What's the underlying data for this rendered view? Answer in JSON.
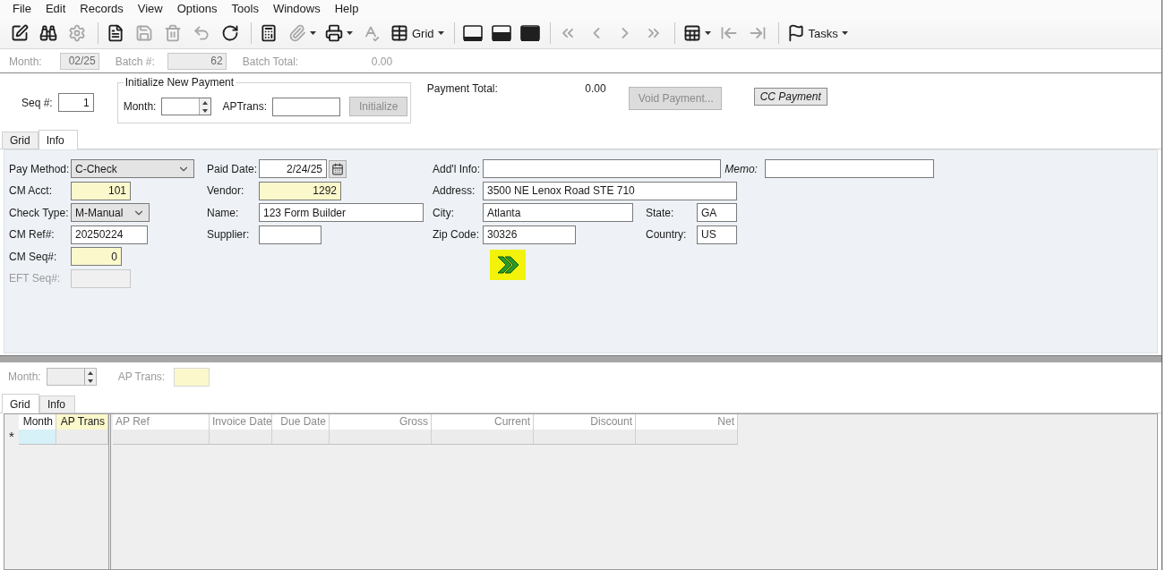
{
  "menu": [
    {
      "label": "File"
    },
    {
      "label": "Edit"
    },
    {
      "label": "Records"
    },
    {
      "label": "View"
    },
    {
      "label": "Options"
    },
    {
      "label": "Tools"
    },
    {
      "label": "Windows"
    },
    {
      "label": "Help"
    }
  ],
  "toolbar": [
    {
      "kind": "button",
      "disabled": false,
      "dropdown": false
    },
    {
      "kind": "button",
      "disabled": false,
      "dropdown": false
    },
    {
      "kind": "button",
      "disabled": true,
      "dropdown": false
    },
    {
      "kind": "separator"
    },
    {
      "kind": "button",
      "disabled": false,
      "dropdown": false
    },
    {
      "kind": "button",
      "disabled": true,
      "dropdown": false
    },
    {
      "kind": "button",
      "disabled": true,
      "dropdown": false
    },
    {
      "kind": "button",
      "disabled": true,
      "dropdown": false
    },
    {
      "kind": "button",
      "disabled": false,
      "dropdown": false
    },
    {
      "kind": "separator"
    },
    {
      "kind": "button",
      "disabled": false,
      "dropdown": false
    },
    {
      "kind": "button",
      "disabled": true,
      "dropdown": true
    },
    {
      "kind": "button",
      "disabled": false,
      "dropdown": true
    },
    {
      "kind": "button",
      "disabled": true,
      "dropdown": false
    },
    {
      "kind": "button",
      "label": "Grid",
      "disabled": false,
      "dropdown": true
    },
    {
      "kind": "separator"
    },
    {
      "kind": "button",
      "disabled": false,
      "dropdown": false
    },
    {
      "kind": "button",
      "disabled": false,
      "dropdown": false
    },
    {
      "kind": "button",
      "disabled": false,
      "dropdown": false
    },
    {
      "kind": "separator"
    },
    {
      "kind": "button",
      "disabled": true,
      "dropdown": false
    },
    {
      "kind": "button",
      "disabled": true,
      "dropdown": false
    },
    {
      "kind": "button",
      "disabled": true,
      "dropdown": false
    },
    {
      "kind": "button",
      "disabled": true,
      "dropdown": false
    },
    {
      "kind": "separator"
    },
    {
      "kind": "button",
      "disabled": false,
      "dropdown": true
    },
    {
      "kind": "button",
      "disabled": true,
      "dropdown": false
    },
    {
      "kind": "button",
      "disabled": true,
      "dropdown": false
    },
    {
      "kind": "separator"
    },
    {
      "kind": "button",
      "label": "Tasks",
      "disabled": false,
      "dropdown": true
    }
  ],
  "batch_bar": [
    {
      "label": "Month:",
      "value": "02/25"
    },
    {
      "label": "Batch #:",
      "value": "62"
    },
    {
      "label": "Batch Total:",
      "value": "0.00"
    }
  ],
  "header": {
    "seq": {
      "label": "Seq #:",
      "value": "1"
    },
    "init_group": {
      "title": "Initialize New Payment",
      "month_label": "Month:",
      "aptrans_label": "APTrans:",
      "button": {
        "label": "Initialize",
        "disabled": true
      }
    },
    "payment_total": {
      "label": "Payment Total:",
      "value": "0.00"
    },
    "void_button": {
      "label": "Void Payment...",
      "disabled": true
    },
    "cc_button": {
      "label": "CC Payment",
      "disabled": false
    }
  },
  "tabs": [
    {
      "label": "Grid",
      "selected": false
    },
    {
      "label": "Info",
      "selected": true
    }
  ],
  "info_form": {
    "columns": [
      {
        "fields": [
          {
            "label": "Pay Method:",
            "value": "C-Check",
            "kind": "dropdown",
            "disabled": false
          },
          {
            "label": "CM Acct:",
            "value": "101",
            "kind": "number",
            "required": true,
            "disabled": false
          },
          {
            "label": "Check Type:",
            "value": "M-Manual",
            "kind": "dropdown",
            "disabled": false
          },
          {
            "label": "CM Ref#:",
            "value": "20250224",
            "kind": "text",
            "required": false,
            "disabled": false
          },
          {
            "label": "CM Seq#:",
            "value": "0",
            "kind": "number",
            "required": true,
            "disabled": false
          },
          {
            "label": "EFT Seq#:",
            "kind": "text",
            "required": false,
            "disabled": true
          }
        ]
      },
      {
        "fields": [
          {
            "label": "Paid Date:",
            "value": "2/24/25",
            "kind": "date",
            "required": false,
            "disabled": false
          },
          {
            "label": "Vendor:",
            "value": "1292",
            "kind": "number",
            "required": true,
            "disabled": false
          },
          {
            "label": "Name:",
            "value": "123 Form Builder",
            "kind": "text",
            "required": false,
            "disabled": false
          },
          {
            "label": "Supplier:",
            "kind": "text",
            "required": false,
            "disabled": false
          }
        ]
      },
      {
        "fields": [
          {
            "label": "Add'l Info:",
            "kind": "text",
            "required": false,
            "disabled": false,
            "side": {
              "label": "Memo:"
            }
          },
          {
            "label": "Address:",
            "value": "3500 NE Lenox Road STE 710",
            "kind": "text",
            "required": false,
            "disabled": false
          },
          {
            "label": "City:",
            "value": "Atlanta",
            "kind": "text",
            "required": false,
            "disabled": false,
            "side": {
              "label": "State:",
              "value": "GA"
            }
          },
          {
            "label": "Zip Code:",
            "value": "30326",
            "kind": "text",
            "required": false,
            "disabled": false,
            "side": {
              "label": "Country:",
              "value": "US"
            }
          }
        ]
      }
    ]
  },
  "lower_filter": {
    "month_label": "Month:",
    "aptrans_label": "AP Trans:"
  },
  "lower_tabs": [
    {
      "label": "Grid",
      "selected": true
    },
    {
      "label": "Info",
      "selected": false
    }
  ],
  "grid": {
    "columns": [
      {
        "label": "Month",
        "frozen": true,
        "required": false,
        "kind": "number"
      },
      {
        "label": "AP Trans",
        "frozen": true,
        "required": true,
        "kind": "number"
      },
      {
        "label": "AP Ref",
        "frozen": false,
        "required": false,
        "kind": "text"
      },
      {
        "label": "Invoice Date",
        "frozen": false,
        "required": false,
        "kind": "number"
      },
      {
        "label": "Due Date",
        "frozen": false,
        "required": false,
        "kind": "number"
      },
      {
        "label": "Gross",
        "frozen": false,
        "required": false,
        "kind": "number"
      },
      {
        "label": "Current",
        "frozen": false,
        "required": false,
        "kind": "number"
      },
      {
        "label": "Discount",
        "frozen": false,
        "required": false,
        "kind": "number"
      },
      {
        "label": "Net",
        "frozen": false,
        "required": false,
        "kind": "number"
      }
    ],
    "rows": [
      {
        "marker": "*",
        "cells": [
          {
            "selected": true
          },
          {
            "selected": false
          },
          {
            "selected": false
          },
          {
            "selected": false
          },
          {
            "selected": false
          },
          {
            "selected": false
          },
          {
            "selected": false
          },
          {
            "selected": false
          },
          {
            "selected": false
          }
        ]
      }
    ]
  }
}
